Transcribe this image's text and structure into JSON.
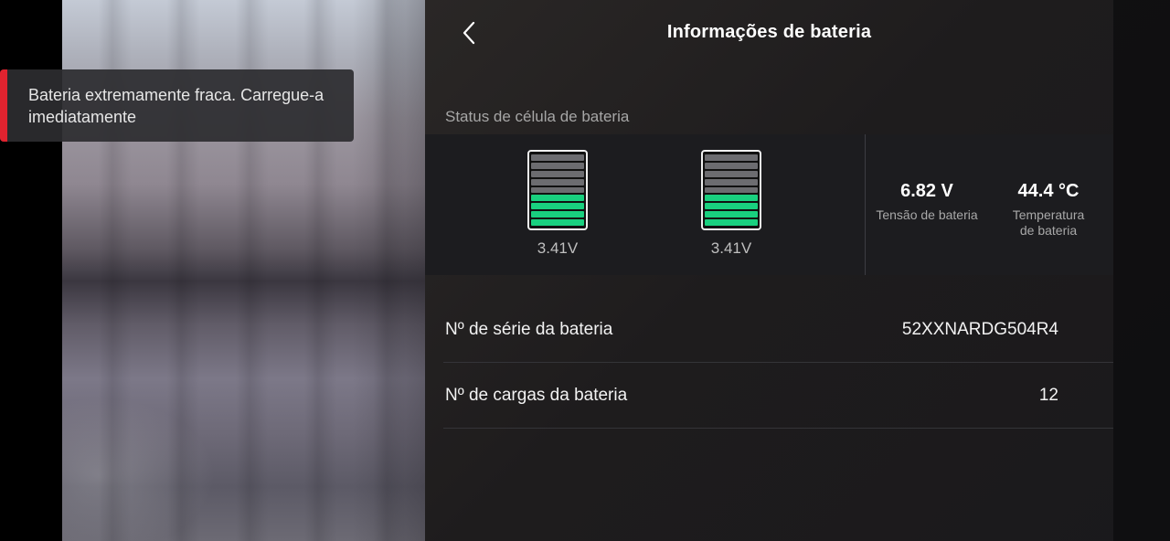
{
  "toast": {
    "message": "Bateria extremamente fraca. Carregue-a imediatamente",
    "accent_color": "#e0232f"
  },
  "header": {
    "title": "Informações de bateria",
    "back_icon": "chevron-left-icon"
  },
  "cells": {
    "section_label": "Status de célula de bateria",
    "items": [
      {
        "voltage": "3.41V",
        "level_fraction": 0.4
      },
      {
        "voltage": "3.41V",
        "level_fraction": 0.4
      }
    ],
    "active_color": "#19d07f"
  },
  "metrics": {
    "voltage": {
      "value": "6.82 V",
      "label": "Tensão de bateria"
    },
    "temperature": {
      "value": "44.4 °C",
      "label_line1": "Temperatura",
      "label_line2": "de bateria"
    }
  },
  "info_rows": [
    {
      "label": "Nº de série da bateria",
      "value": "52XXNARDG504R4"
    },
    {
      "label": "Nº de cargas da bateria",
      "value": "12"
    }
  ]
}
